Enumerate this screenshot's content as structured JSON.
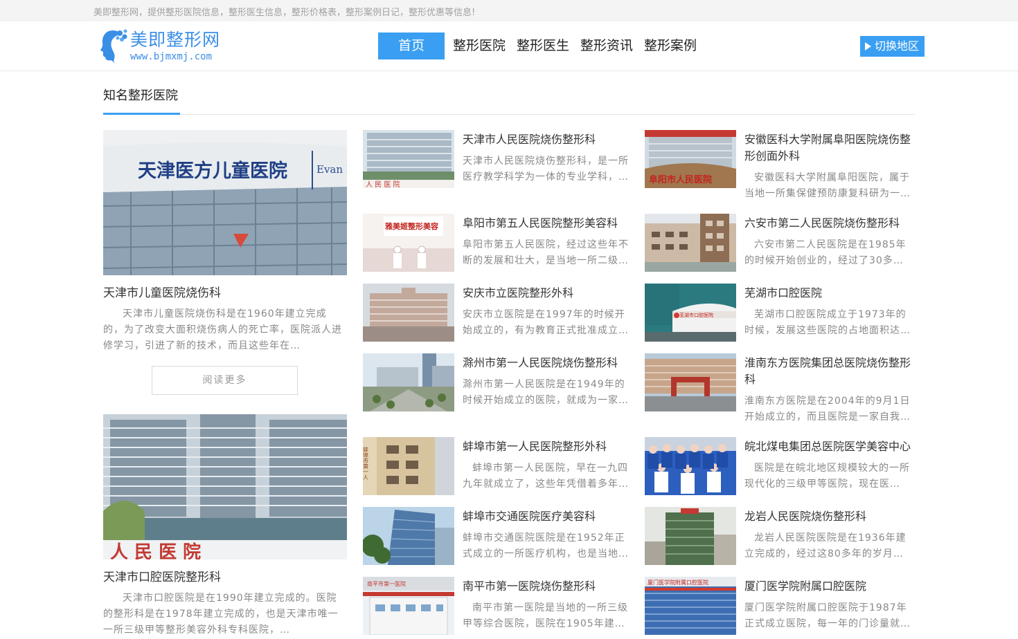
{
  "topbar": {
    "text": "美即整形网，提供整形医院信息，整形医生信息，整形价格表，整形案例日记，整形优惠等信息!"
  },
  "logo": {
    "name": "美即整形网",
    "url": "www.bjmxmj.com",
    "icon": "woman-face-flower-logo"
  },
  "nav": {
    "items": [
      "首页",
      "整形医院",
      "整形医生",
      "整形资讯",
      "整形案例"
    ],
    "active_index": 0
  },
  "region_button": {
    "label": "切换地区",
    "icon": "triangle-right-icon"
  },
  "section": {
    "title": "知名整形医院"
  },
  "featured": [
    {
      "sign": "天津医方儿童医院",
      "sign_en": "Evan H",
      "title": "天津市儿童医院烧伤科",
      "desc": "天津市儿童医院烧伤科是在1960年建立完成的，为了改变大面积烧伤病人的死亡率，医院派人进修学习，引进了新的技术，而且这些年在…",
      "more_label": "阅读更多"
    },
    {
      "sign": "人 民 医 院",
      "title": "天津市口腔医院整形科",
      "desc": "天津市口腔医院是在1990年建立完成的。医院的整形科是在1978年建立完成的，也是天津市唯一一所三级甲等整形美容外科专科医院，…"
    }
  ],
  "cards_left": [
    {
      "title": "天津市人民医院烧伤整形科",
      "desc": "天津市人民医院烧伤整形科，是一所医疗教学科学为一体的专业学科，…",
      "thumb_text": "人 民 医 院",
      "indent": false
    },
    {
      "title": "阜阳市第五人民医院整形美容科",
      "desc": "阜阳市第五人民医院，经过这些年不断的发展和壮大，是当地一所二级…",
      "thumb_text": "雅美姬整形美容",
      "indent": false
    },
    {
      "title": "安庆市立医院整形外科",
      "desc": "安庆市立医院是在1997年的时候开始成立的，有为教育正式批准成立…",
      "thumb_text": "",
      "indent": false
    },
    {
      "title": "滁州市第一人民医院烧伤整形科",
      "desc": "滁州市第一人民医院是在1949年的时候开始成立的医院，就成为一家…",
      "thumb_text": "",
      "indent": false
    },
    {
      "title": "蚌埠市第一人民医院整形外科",
      "desc": "蚌埠市第一人民医院，早在一九四九年就成立了，这些年凭借着多年…",
      "thumb_text": "蚌埠市第一人",
      "indent": true
    },
    {
      "title": "蚌埠市交通医院医疗美容科",
      "desc": "蚌埠市交通医院医院是在1952年正式成立的一所医疗机构，也是当地…",
      "thumb_text": "",
      "indent": false
    },
    {
      "title": "南平市第一医院烧伤整形科",
      "desc": "南平市第一医院是当地的一所三级甲等综合医院，医院在1905年建…",
      "thumb_text": "南平市第一医院",
      "indent": true
    }
  ],
  "cards_right": [
    {
      "title": "安徽医科大学附属阜阳医院烧伤整形创面外科",
      "desc": "安徽医科大学附属阜阳医院，属于当地一所集保健预防康复科研为一…",
      "thumb_text": "阜阳市人民医院",
      "indent": true
    },
    {
      "title": "六安市第二人民医院烧伤整形科",
      "desc": "六安市第二人民医院是在1985年的时候开始创业的，经过了30多…",
      "thumb_text": "",
      "indent": true
    },
    {
      "title": "芜湖市口腔医院",
      "desc": "芜湖市口腔医院成立于1973年的时候，发展这些医院的占地面积达…",
      "thumb_text": "芜湖市口腔医院",
      "indent": true
    },
    {
      "title": "淮南东方医院集团总医院烧伤整形科",
      "desc": "淮南东方医院是在2004年的9月1日开始成立的，而且医院是一家自我…",
      "thumb_text": "",
      "indent": false
    },
    {
      "title": "皖北煤电集团总医院医学美容中心",
      "desc": "医院是在皖北地区规模较大的一所现代化的三级甲等医院，现在医…",
      "thumb_text": "",
      "indent": true
    },
    {
      "title": "龙岩人民医院烧伤整形科",
      "desc": "龙岩人民医院医院是在1936年建立完成的，经过这80多年的岁月…",
      "thumb_text": "",
      "indent": true
    },
    {
      "title": "厦门医学院附属口腔医院",
      "desc": "厦门医学院附属口腔医院于1987年正式成立医院，每一年的门诊量就…",
      "thumb_text": "厦门医学院附属口腔医院",
      "indent": false
    }
  ],
  "colors": {
    "accent": "#3a9ff2",
    "text": "#333333",
    "muted": "#888888",
    "topbar_bg": "#f4f4f4"
  }
}
